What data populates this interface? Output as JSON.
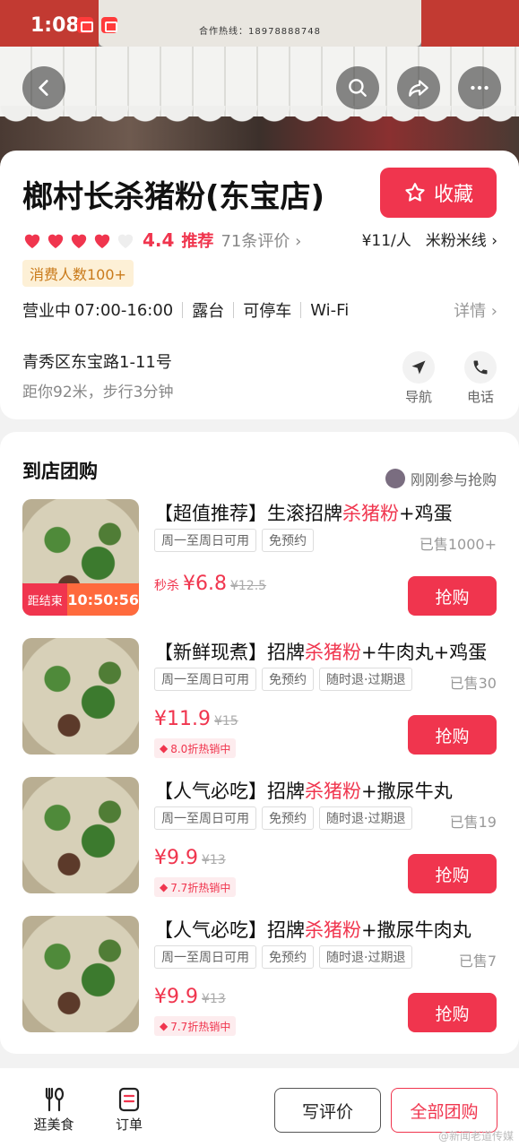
{
  "status_bar": {
    "time": "1:08"
  },
  "hero": {
    "sign_text": "合作热线：18978888748"
  },
  "shop": {
    "name": "榔村长杀猪粉(东宝店)",
    "favorite_label": "收藏",
    "rating_hearts": 4.4,
    "score": "4.4",
    "recommend": "推荐",
    "reviews": "71条评价 ›",
    "price_per_person": "¥11/人",
    "category": "米粉米线 ›",
    "consumer_badge": "消费人数100+",
    "status": "营业中",
    "hours": "07:00-16:00",
    "facilities": [
      "露台",
      "可停车",
      "Wi-Fi"
    ],
    "detail_link": "详情 ›",
    "address": "青秀区东宝路1-11号",
    "distance": "距你92米，步行3分钟",
    "nav_label": "导航",
    "phone_label": "电话"
  },
  "group_buy": {
    "title": "到店团购",
    "recent_activity": "刚刚参与抢购",
    "deals": [
      {
        "title_prefix": "【超值推荐】生滚招牌",
        "title_highlight": "杀猪粉",
        "title_suffix": "+鸡蛋",
        "tags": [
          "周一至周日可用",
          "免预约"
        ],
        "sold": "已售1000+",
        "seckill_label": "秒杀",
        "price": "¥6.8",
        "old_price": "¥12.5",
        "timer_label": "距结束",
        "timer": "10:50:56",
        "buy_label": "抢购"
      },
      {
        "title_prefix": "【新鲜现煮】招牌",
        "title_highlight": "杀猪粉",
        "title_suffix": "+牛肉丸+鸡蛋",
        "tags": [
          "周一至周日可用",
          "免预约",
          "随时退·过期退"
        ],
        "sold": "已售30",
        "price": "¥11.9",
        "old_price": "¥15",
        "hot_label": "8.0折热销中",
        "buy_label": "抢购"
      },
      {
        "title_prefix": "【人气必吃】招牌",
        "title_highlight": "杀猪粉",
        "title_suffix": "+撒尿牛丸",
        "tags": [
          "周一至周日可用",
          "免预约",
          "随时退·过期退"
        ],
        "sold": "已售19",
        "price": "¥9.9",
        "old_price": "¥13",
        "hot_label": "7.7折热销中",
        "buy_label": "抢购"
      },
      {
        "title_prefix": "【人气必吃】招牌",
        "title_highlight": "杀猪粉",
        "title_suffix": "+撒尿牛肉丸",
        "tags": [
          "周一至周日可用",
          "免预约",
          "随时退·过期退"
        ],
        "sold": "已售7",
        "price": "¥9.9",
        "old_price": "¥13",
        "hot_label": "7.7折热销中",
        "buy_label": "抢购"
      }
    ]
  },
  "bottom_bar": {
    "tab_food": "逛美食",
    "tab_orders": "订单",
    "write_review": "写评价",
    "all_deals": "全部团购",
    "watermark": "@新闻老道传媒"
  },
  "colors": {
    "accent": "#f0354e",
    "badge_bg": "#fdf0d6",
    "badge_text": "#c97a1a"
  }
}
